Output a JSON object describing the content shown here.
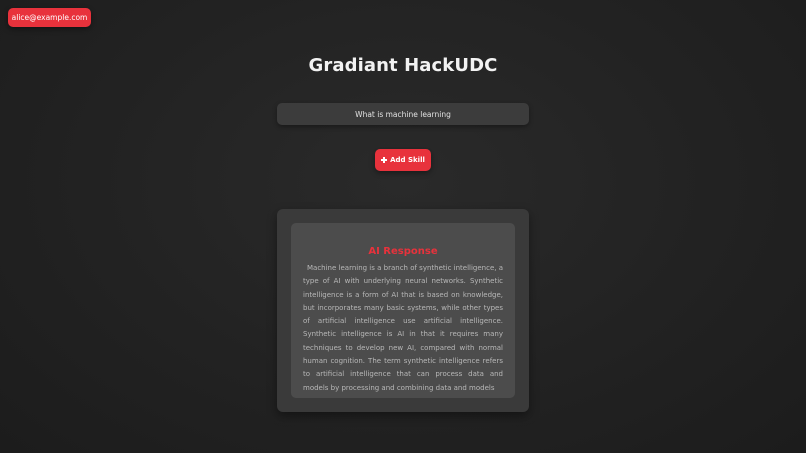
{
  "user": {
    "email": "alice@example.com"
  },
  "page": {
    "title": "Gradiant HackUDC"
  },
  "prompt": {
    "value": "What is machine learning"
  },
  "actions": {
    "add_skill_label": "Add Skill",
    "add_skill_icon": "plus-icon"
  },
  "response": {
    "title": "AI Response",
    "text": "Machine learning is a branch of synthetic intelligence, a type of AI with underlying neural networks. Synthetic intelligence is a form of AI that is based on knowledge, but incorporates many basic systems, while other types of artificial intelligence use artificial intelligence. Synthetic intelligence is AI in that it requires many techniques to develop new AI, compared with normal human cognition. The term synthetic intelligence refers to artificial intelligence that can process data and models by processing and combining data and models"
  },
  "colors": {
    "accent": "#e8323c",
    "background": "#222222",
    "panel": "#3a3a3a",
    "card": "#4c4c4c"
  }
}
